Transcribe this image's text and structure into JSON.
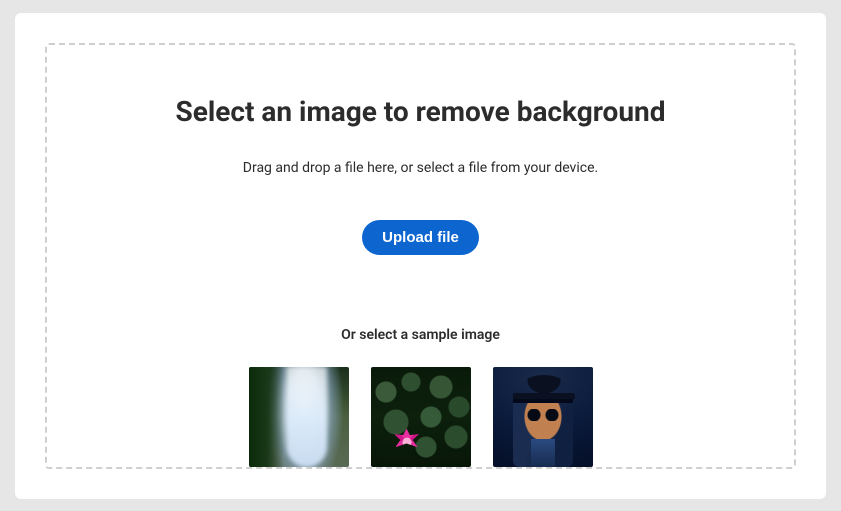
{
  "header": {
    "title": "Select an image to remove background",
    "subtitle": "Drag and drop a file here, or select a file from your device."
  },
  "actions": {
    "upload_label": "Upload file"
  },
  "samples": {
    "label": "Or select a sample image",
    "items": [
      {
        "name": "waterfall"
      },
      {
        "name": "lotus"
      },
      {
        "name": "man-in-hat"
      }
    ]
  }
}
